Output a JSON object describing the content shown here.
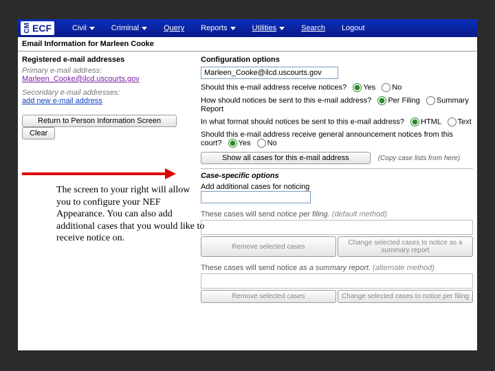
{
  "nav": {
    "logo_small": "CM",
    "logo_big": "ECF",
    "items": [
      "Civil",
      "Criminal",
      "Query",
      "Reports",
      "Utilities",
      "Search",
      "Logout"
    ],
    "dropdown_flags": [
      true,
      true,
      false,
      true,
      true,
      false,
      false
    ],
    "underline_flags": [
      false,
      false,
      true,
      false,
      true,
      true,
      false
    ]
  },
  "page_title": "Email Information for Marleen Cooke",
  "left": {
    "registered_head": "Registered e-mail addresses",
    "primary_label": "Primary e-mail address:",
    "primary_link": "Marleen_Cooke@ilcd.uscourts.gov",
    "secondary_label": "Secondary e-mail addresses:",
    "secondary_link": "add new e-mail address",
    "btn_return": "Return to Person Information Screen",
    "btn_clear": "Clear"
  },
  "right": {
    "config_head": "Configuration options",
    "email_value": "Marleen_Cooke@ilcd.uscourts.gov",
    "q1": "Should this e-mail address receive notices?",
    "q1_opts": [
      "Yes",
      "No"
    ],
    "q2": "How should notices be sent to this e-mail address?",
    "q2_opts": [
      "Per Filing",
      "Summary Report"
    ],
    "q3": "In what format should notices be sent to this e-mail address?",
    "q3_opts": [
      "HTML",
      "Text"
    ],
    "q4": "Should this e-mail address receive general announcement notices from this court?",
    "q4_opts": [
      "Yes",
      "No"
    ],
    "btn_showall": "Show all cases for this e-mail address",
    "copy_hint": "(Copy case lists from here)",
    "case_head": "Case-specific options",
    "add_cases_label": "Add additional cases for noticing",
    "perfiling_msg_a": "These cases will send notice ",
    "perfiling_msg_b": "per filing.",
    "perfiling_msg_c": " (default method)",
    "btn_remove": "Remove selected cases",
    "btn_change_summary": "Change selected cases to notice as a summary report",
    "summary_msg_a": "These cases will send notice ",
    "summary_msg_b": "as a summary report.",
    "summary_msg_c": " (alternate method)",
    "btn_change_perfiling": "Change selected cases to notice per filing"
  },
  "caption": "The screen to your right will allow you to configure your NEF Appearance.   You can also add additional cases that you would like to receive notice on."
}
